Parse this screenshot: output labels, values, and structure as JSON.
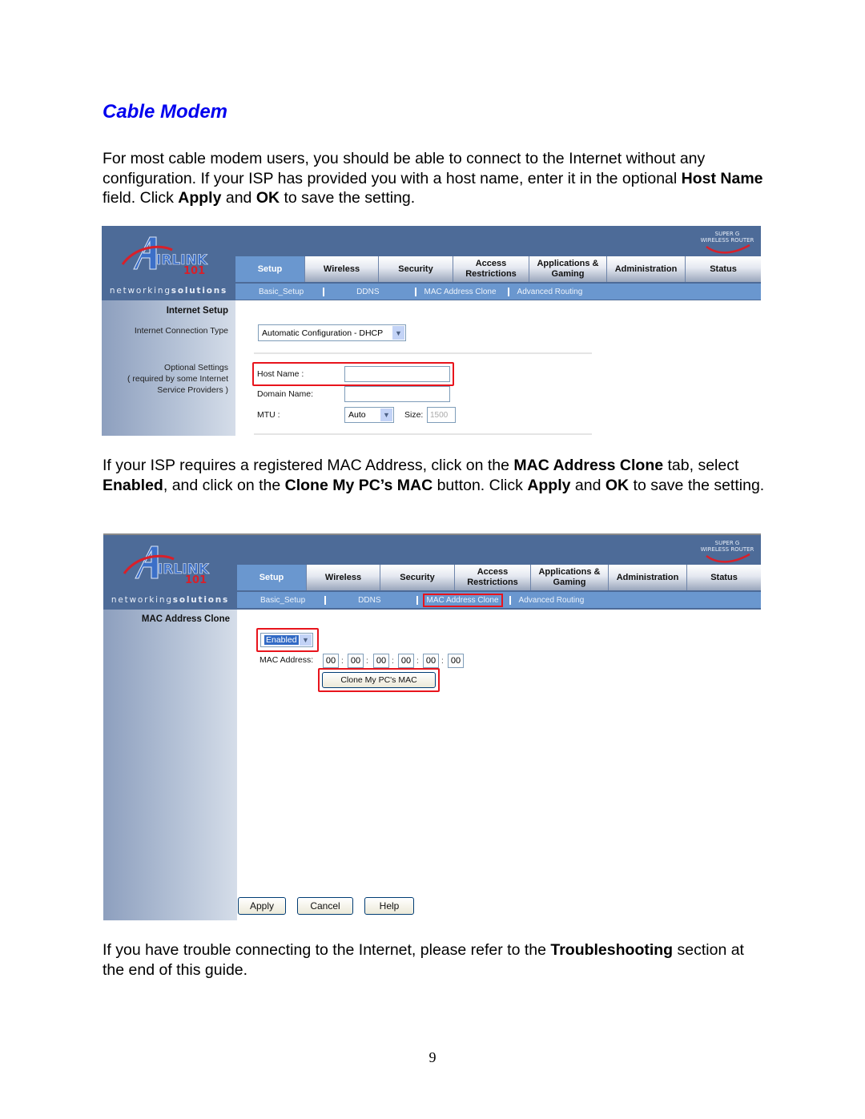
{
  "doc": {
    "heading": "Cable Modem",
    "para1": {
      "t1": "For most cable modem users, you should be able to connect to the Internet without any configuration. If your ISP has provided you with a host name, enter it in the optional ",
      "b1": "Host Name",
      "t2": " field. Click ",
      "b2": "Apply",
      "t3": " and ",
      "b3": "OK",
      "t4": " to save the setting."
    },
    "para2": {
      "t1": "If your ISP requires a registered MAC Address, click on the ",
      "b1": "MAC Address Clone",
      "t2": " tab, select ",
      "b2": "Enabled",
      "t3": ", and click on the ",
      "b3": "Clone My PC’s MAC",
      "t4": " button. Click ",
      "b4": "Apply",
      "t5": " and ",
      "b5": "OK",
      "t6": " to save the setting."
    },
    "para3": {
      "t1": "If you have trouble connecting to the Internet, please refer to the ",
      "b1": "Troubleshooting",
      "t2": " section at the end of this guide."
    },
    "page_number": "9"
  },
  "router": {
    "brand": "AIRLINK",
    "brand_sub": "101",
    "tagline_a": "networking",
    "tagline_b": "solutions",
    "badge_line1": "SUPER G",
    "badge_line2": "WIRELESS ROUTER",
    "tabs": [
      {
        "label": "Setup"
      },
      {
        "label": "Wireless"
      },
      {
        "label": "Security"
      },
      {
        "label": "Access Restrictions"
      },
      {
        "label": "Applications & Gaming"
      },
      {
        "label": "Administration"
      },
      {
        "label": "Status"
      }
    ],
    "subtabs": [
      "Basic_Setup",
      "DDNS",
      "MAC Address Clone",
      "Advanced Routing"
    ],
    "highlight_color": "#e8141c"
  },
  "shot1": {
    "section_title": "Internet Setup",
    "conn_type_label": "Internet Connection Type",
    "conn_type_value": "Automatic Configuration - DHCP",
    "optional_l1": "Optional Settings",
    "optional_l2": "( required by some Internet",
    "optional_l3": "Service Providers )",
    "host_name_label": "Host Name :",
    "host_name_value": "",
    "domain_name_label": "Domain Name:",
    "domain_name_value": "",
    "mtu_label": "MTU :",
    "mtu_value": "Auto",
    "size_label": "Size:",
    "size_value": "1500"
  },
  "shot2": {
    "section_title": "MAC Address Clone",
    "clone_select_value": "Enabled",
    "mac_label": "MAC Address:",
    "mac_octets": [
      "00",
      "00",
      "00",
      "00",
      "00",
      "00"
    ],
    "clone_button": "Clone My PC's MAC",
    "apply": "Apply",
    "cancel": "Cancel",
    "help": "Help"
  }
}
